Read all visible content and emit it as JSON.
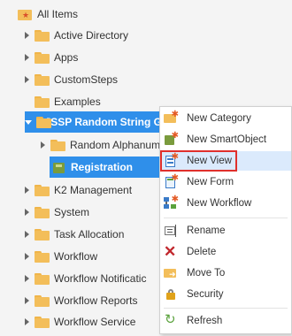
{
  "tree": {
    "root_label": "All Items",
    "items": [
      {
        "label": "Active Directory"
      },
      {
        "label": "Apps"
      },
      {
        "label": "CustomSteps"
      },
      {
        "label": "Examples"
      },
      {
        "label": "JSSP Random String G"
      },
      {
        "label": "Random Alphanum"
      },
      {
        "label": "Registration"
      },
      {
        "label": "K2 Management"
      },
      {
        "label": "System"
      },
      {
        "label": "Task Allocation"
      },
      {
        "label": "Workflow"
      },
      {
        "label": "Workflow Notificatic"
      },
      {
        "label": "Workflow Reports"
      },
      {
        "label": "Workflow Service"
      }
    ]
  },
  "context_menu": {
    "items": [
      {
        "label": "New Category",
        "icon": "folder-new-icon"
      },
      {
        "label": "New SmartObject",
        "icon": "smartobject-new-icon"
      },
      {
        "label": "New View",
        "icon": "view-new-icon"
      },
      {
        "label": "New Form",
        "icon": "form-new-icon"
      },
      {
        "label": "New Workflow",
        "icon": "workflow-new-icon"
      },
      {
        "label": "Rename",
        "icon": "rename-icon"
      },
      {
        "label": "Delete",
        "icon": "delete-icon"
      },
      {
        "label": "Move To",
        "icon": "move-to-icon"
      },
      {
        "label": "Security",
        "icon": "security-icon"
      },
      {
        "label": "Refresh",
        "icon": "refresh-icon"
      }
    ]
  },
  "colors": {
    "selection": "#2f8fea",
    "highlight_border": "#e0302c",
    "folder": "#f3be5a"
  }
}
